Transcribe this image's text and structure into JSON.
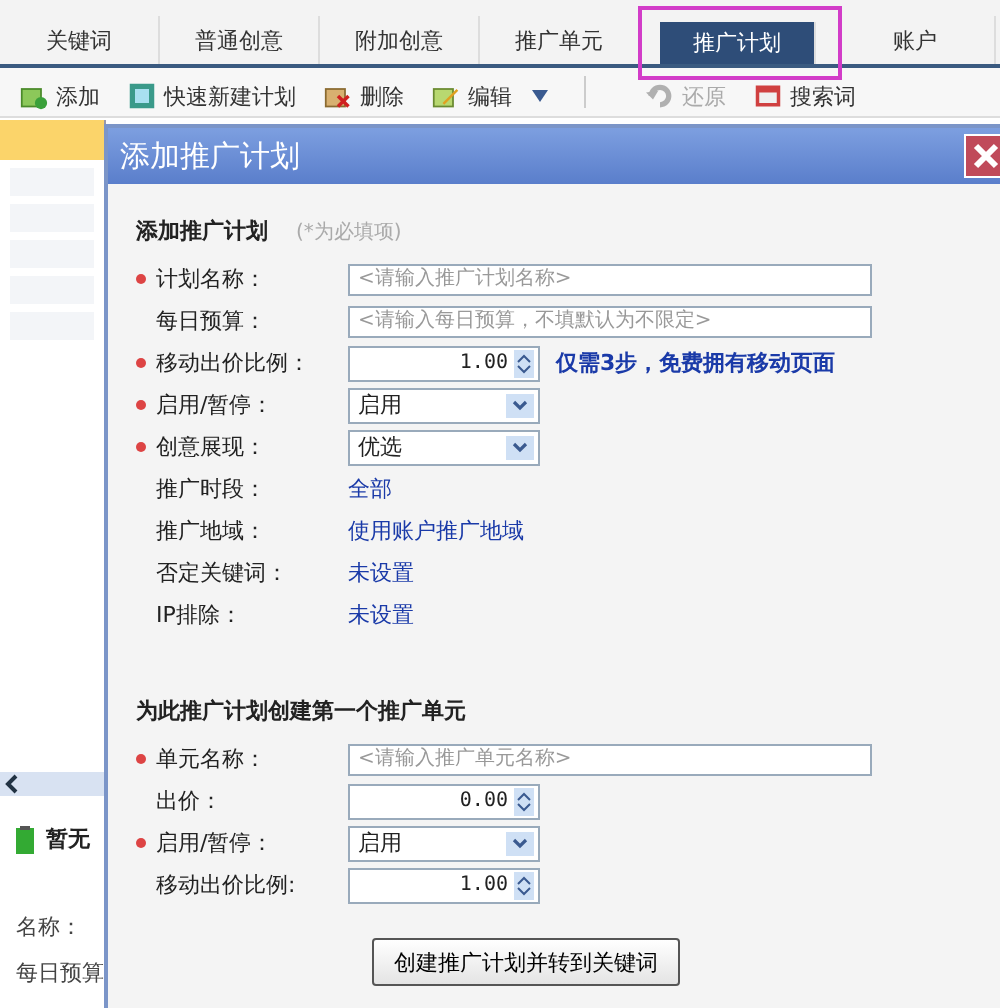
{
  "tabs": [
    {
      "label": "关键词",
      "selected": false
    },
    {
      "label": "普通创意",
      "selected": false
    },
    {
      "label": "附加创意",
      "selected": false
    },
    {
      "label": "推广单元",
      "selected": false
    },
    {
      "label": "推广计划",
      "selected": true,
      "highlighted": true
    },
    {
      "label": "账户",
      "selected": false
    }
  ],
  "toolbar": [
    {
      "label": "添加",
      "disabled": false
    },
    {
      "label": "快速新建计划",
      "disabled": false
    },
    {
      "label": "删除",
      "disabled": false
    },
    {
      "label": "编辑",
      "disabled": false,
      "dropdown": true
    },
    {
      "label": "还原",
      "disabled": true
    },
    {
      "label": "搜索词",
      "disabled": false
    }
  ],
  "background_panel": {
    "status": "暂无",
    "labels": [
      "名称：",
      "每日预算"
    ]
  },
  "dialog": {
    "title": "添加推广计划",
    "sections": [
      {
        "heading": "添加推广计划",
        "note": "(*为必填项)",
        "fields": [
          {
            "kind": "text",
            "label": "计划名称：",
            "required": true,
            "placeholder": "<请输入推广计划名称>"
          },
          {
            "kind": "text",
            "label": "每日预算：",
            "required": false,
            "placeholder": "<请输入每日预算，不填默认为不限定>"
          },
          {
            "kind": "spin",
            "label": "移动出价比例：",
            "required": true,
            "value": "1.00",
            "hint": "仅需3步，免费拥有移动页面"
          },
          {
            "kind": "select",
            "label": "启用/暂停：",
            "required": true,
            "value": "启用"
          },
          {
            "kind": "select",
            "label": "创意展现：",
            "required": true,
            "value": "优选"
          },
          {
            "kind": "link",
            "label": "推广时段：",
            "required": false,
            "value": "全部"
          },
          {
            "kind": "link",
            "label": "推广地域：",
            "required": false,
            "value": "使用账户推广地域"
          },
          {
            "kind": "link",
            "label": "否定关键词：",
            "required": false,
            "value": "未设置"
          },
          {
            "kind": "link",
            "label": "IP排除：",
            "required": false,
            "value": "未设置"
          }
        ]
      },
      {
        "heading": "为此推广计划创建第一个推广单元",
        "fields": [
          {
            "kind": "text",
            "label": "单元名称：",
            "required": true,
            "placeholder": "<请输入推广单元名称>"
          },
          {
            "kind": "spin",
            "label": "出价：",
            "required": false,
            "value": "0.00"
          },
          {
            "kind": "select",
            "label": "启用/暂停：",
            "required": true,
            "value": "启用"
          },
          {
            "kind": "spin",
            "label": "移动出价比例:",
            "required": false,
            "value": "1.00"
          }
        ]
      }
    ],
    "submit": "创建推广计划并转到关键词"
  }
}
